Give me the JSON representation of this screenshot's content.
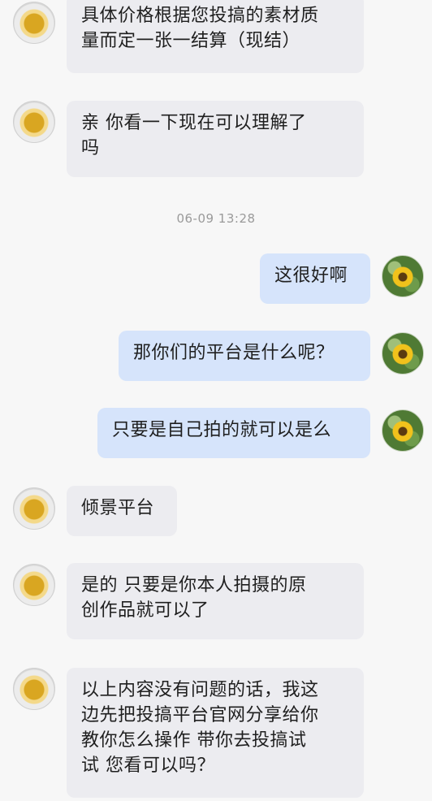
{
  "timestamp": "06-09 13:28",
  "messages": [
    {
      "side": "left",
      "text": "具体价格根据您投搞的素材质\n量而定一张一结算（现结）"
    },
    {
      "side": "left",
      "text": "亲  你看一下现在可以理解了\n吗"
    },
    {
      "side": "right",
      "text": "这很好啊"
    },
    {
      "side": "right",
      "text": "那你们的平台是什么呢？"
    },
    {
      "side": "right",
      "text": "只要是自己拍的就可以是么"
    },
    {
      "side": "left",
      "text": "倾景平台"
    },
    {
      "side": "left",
      "text": "是的  只要是你本人拍摄的原\n创作品就可以了"
    },
    {
      "side": "left",
      "text": "以上内容没有问题的话，我这\n边先把投搞平台官网分享给你\n教你怎么操作  带你去投搞试\n试  您看可以吗？"
    }
  ]
}
